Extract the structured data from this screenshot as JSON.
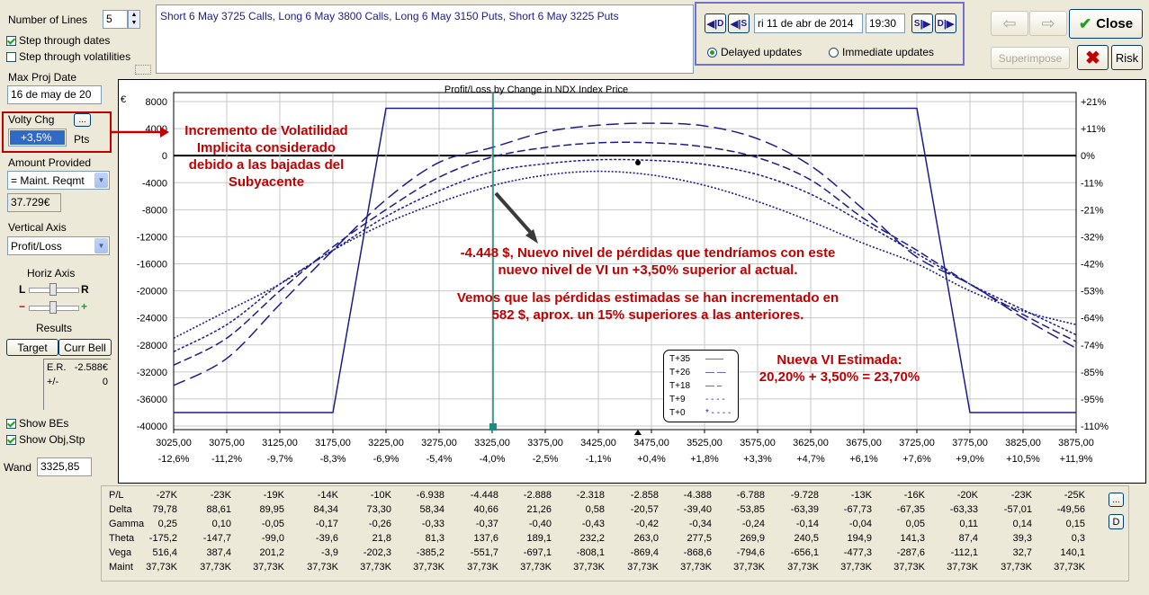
{
  "left_panel": {
    "number_of_lines_label": "Number of Lines",
    "number_of_lines_value": "5",
    "step_dates_label": "Step through dates",
    "step_vols_label": "Step through volatilities",
    "max_proj_date_label": "Max Proj Date",
    "max_proj_date_value": "16 de may de 20",
    "volty_chg_label": "Volty Chg",
    "volty_chg_btn": "...",
    "volty_chg_value": "+3,5%",
    "volty_chg_unit": "Pts",
    "amount_provided_label": "Amount Provided",
    "amount_provided_value": "= Maint. Reqmt",
    "amount_value": "37.729€",
    "vertical_axis_label": "Vertical Axis",
    "vertical_axis_value": "Profit/Loss",
    "horiz_axis_label": "Horiz Axis",
    "slider_left": "L",
    "slider_right": "R",
    "slider_minus": "−",
    "slider_plus": "+",
    "results_label": "Results",
    "target_btn": "Target",
    "curr_bell_btn": "Curr Bell",
    "er_label": "E.R.",
    "er_value": "-2.588€",
    "pm_label": "+/-",
    "pm_value": "0",
    "show_bes_label": "Show BEs",
    "show_obj_label": "Show Obj,Stp",
    "wand_label": "Wand",
    "wand_value": "3325,85"
  },
  "position_text": "Short 6 May 3725 Calls, Long 6 May 3800 Calls, Long 6 May 3150 Puts, Short 6 May 3225 Puts",
  "date_panel": {
    "btn_dd": "D",
    "btn_ds": "S",
    "date_value": "ri 11 de abr de 2014",
    "time_value": "19:30",
    "btn_fs": "S",
    "btn_fd": "D",
    "delayed_label": "Delayed updates",
    "immediate_label": "Immediate updates"
  },
  "right_buttons": {
    "close": "Close",
    "superimpose": "Superimpose",
    "risk": "Risk"
  },
  "chart_data": {
    "type": "line",
    "title": "Profit/Loss by Change in NDX Index Price",
    "currency_symbol": "€",
    "x_ticks": [
      "3025,00",
      "3075,00",
      "3125,00",
      "3175,00",
      "3225,00",
      "3275,00",
      "3325,00",
      "3375,00",
      "3425,00",
      "3475,00",
      "3525,00",
      "3575,00",
      "3625,00",
      "3675,00",
      "3725,00",
      "3775,00",
      "3825,00",
      "3875,00"
    ],
    "x_pct_ticks": [
      "-12,6%",
      "-11,2%",
      "-9,7%",
      "-8,3%",
      "-6,9%",
      "-5,4%",
      "-4,0%",
      "-2,5%",
      "-1,1%",
      "+0,4%",
      "+1,8%",
      "+3,3%",
      "+4,7%",
      "+6,1%",
      "+7,6%",
      "+9,0%",
      "+10,5%",
      "+11,9%"
    ],
    "y_ticks": [
      "8000",
      "4000",
      "0",
      "-4000",
      "-8000",
      "-12000",
      "-16000",
      "-20000",
      "-24000",
      "-28000",
      "-32000",
      "-36000",
      "-40000"
    ],
    "y_right_ticks": [
      "+21%",
      "+11%",
      "0%",
      "-11%",
      "-21%",
      "-32%",
      "-42%",
      "-53%",
      "-64%",
      "-74%",
      "-85%",
      "-95%",
      "-110%"
    ],
    "xlim": [
      3010,
      3885
    ],
    "ylim": [
      -40000,
      9000
    ],
    "x": [
      3025,
      3075,
      3125,
      3175,
      3225,
      3275,
      3325,
      3375,
      3425,
      3475,
      3525,
      3575,
      3625,
      3675,
      3725,
      3775,
      3825,
      3875
    ],
    "series": [
      {
        "name": "T+35",
        "style": "solid",
        "values": [
          -38000,
          -38000,
          -38000,
          -38000,
          7000,
          7000,
          7000,
          7000,
          7000,
          7000,
          7000,
          7000,
          7000,
          7000,
          7000,
          -38000,
          -38000,
          -38000
        ]
      },
      {
        "name": "T+26",
        "style": "longdash",
        "values": [
          -34000,
          -30000,
          -22000,
          -14000,
          -6500,
          -1000,
          1200,
          3500,
          4500,
          4800,
          4400,
          2500,
          -1500,
          -8000,
          -15000,
          -19000,
          -24000,
          -28500
        ]
      },
      {
        "name": "T+18",
        "style": "dash",
        "values": [
          -31000,
          -27000,
          -20000,
          -13500,
          -8000,
          -3200,
          -200,
          1200,
          1900,
          1900,
          1300,
          -300,
          -3600,
          -9300,
          -14000,
          -19000,
          -23500,
          -27500
        ]
      },
      {
        "name": "T+9",
        "style": "dot",
        "values": [
          -29000,
          -25000,
          -19000,
          -14000,
          -9000,
          -5200,
          -2400,
          -1200,
          -600,
          -700,
          -1300,
          -2800,
          -5700,
          -10000,
          -14500,
          -19000,
          -22800,
          -26500
        ]
      },
      {
        "name": "T+0",
        "style": "finedot",
        "values": [
          -27000,
          -23000,
          -19000,
          -14000,
          -10000,
          -6938,
          -4448,
          -2888,
          -2318,
          -2858,
          -4388,
          -6788,
          -9728,
          -13000,
          -16000,
          -20000,
          -23000,
          -25000
        ]
      }
    ],
    "wand_x": 3325.85,
    "legend": [
      "T+35",
      "T+26",
      "T+18",
      "T+9",
      "T+0"
    ],
    "legend_markers": [
      "——",
      "— —",
      "— –",
      "- - - -",
      "* - - - -"
    ]
  },
  "annotations": {
    "vol_inc_1": "Incremento de Volatilidad",
    "vol_inc_2": "Implicita considerado",
    "vol_inc_3": "debido a las bajadas del",
    "vol_inc_4": "Subyacente",
    "loss_1": "-4.448 $, Nuevo nivel de pérdidas que tendríamos con este",
    "loss_2": "nuevo nivel de VI un +3,50% superior al actual.",
    "inc_1": "Vemos que las pérdidas estimadas se han incrementado en",
    "inc_2": "582 $, aprox. un 15% superiores a las anteriores.",
    "vi_1": "Nueva VI  Estimada:",
    "vi_2": "20,20% + 3,50% = 23,70%"
  },
  "results_table": {
    "rows": [
      {
        "label": "P/L",
        "values": [
          "-27K",
          "-23K",
          "-19K",
          "-14K",
          "-10K",
          "-6.938",
          "-4.448",
          "-2.888",
          "-2.318",
          "-2.858",
          "-4.388",
          "-6.788",
          "-9.728",
          "-13K",
          "-16K",
          "-20K",
          "-23K",
          "-25K"
        ]
      },
      {
        "label": "Delta",
        "values": [
          "79,78",
          "88,61",
          "89,95",
          "84,34",
          "73,30",
          "58,34",
          "40,66",
          "21,26",
          "0,58",
          "-20,57",
          "-39,40",
          "-53,85",
          "-63,39",
          "-67,73",
          "-67,35",
          "-63,33",
          "-57,01",
          "-49,56"
        ]
      },
      {
        "label": "Gamma",
        "values": [
          "0,25",
          "0,10",
          "-0,05",
          "-0,17",
          "-0,26",
          "-0,33",
          "-0,37",
          "-0,40",
          "-0,43",
          "-0,42",
          "-0,34",
          "-0,24",
          "-0,14",
          "-0,04",
          "0,05",
          "0,11",
          "0,14",
          "0,15"
        ]
      },
      {
        "label": "Theta",
        "values": [
          "-175,2",
          "-147,7",
          "-99,0",
          "-39,6",
          "21,8",
          "81,3",
          "137,6",
          "189,1",
          "232,2",
          "263,0",
          "277,5",
          "269,9",
          "240,5",
          "194,9",
          "141,3",
          "87,4",
          "39,3",
          "0,3"
        ]
      },
      {
        "label": "Vega",
        "values": [
          "516,4",
          "387,4",
          "201,2",
          "-3,9",
          "-202,3",
          "-385,2",
          "-551,7",
          "-697,1",
          "-808,1",
          "-869,4",
          "-868,6",
          "-794,6",
          "-656,1",
          "-477,3",
          "-287,6",
          "-112,1",
          "32,7",
          "140,1"
        ]
      },
      {
        "label": "Maint",
        "values": [
          "37,73K",
          "37,73K",
          "37,73K",
          "37,73K",
          "37,73K",
          "37,73K",
          "37,73K",
          "37,73K",
          "37,73K",
          "37,73K",
          "37,73K",
          "37,73K",
          "37,73K",
          "37,73K",
          "37,73K",
          "37,73K",
          "37,73K",
          "37,73K"
        ]
      }
    ],
    "btn_more": "...",
    "btn_d": "D"
  }
}
